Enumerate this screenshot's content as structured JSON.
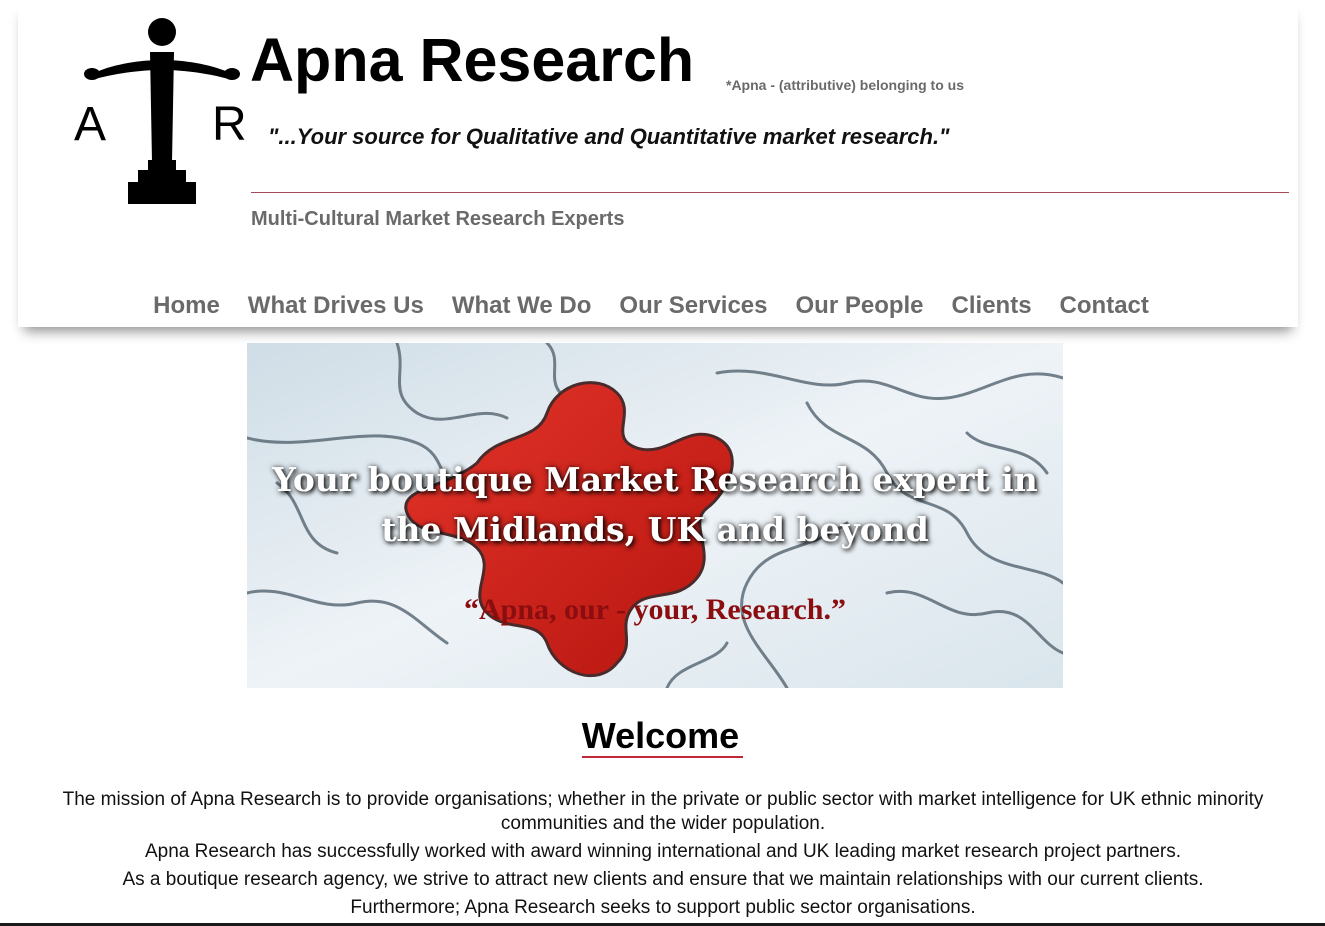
{
  "header": {
    "logo_letters": {
      "left": "A",
      "right": "R"
    },
    "title": "Apna Research",
    "title_note": "*Apna - (attributive) belonging to us",
    "tagline": "\"...Your source for Qualitative and Quantitative market research.\"",
    "subtitle": "Multi-Cultural Market Research Experts"
  },
  "nav": {
    "items": [
      {
        "label": "Home"
      },
      {
        "label": "What Drives Us"
      },
      {
        "label": "What We Do"
      },
      {
        "label": "Our Services"
      },
      {
        "label": "Our People"
      },
      {
        "label": "Clients"
      },
      {
        "label": "Contact"
      }
    ]
  },
  "hero": {
    "headline_line1": "Your boutique Market Research expert in",
    "headline_line2": "the Midlands, UK and beyond",
    "motto": "“Apna, our - your, Research.”"
  },
  "welcome": {
    "heading": "Welcome",
    "paragraphs": [
      "The mission of Apna Research is to provide organisations; whether in the private or public sector with market intelligence for UK ethnic minority communities and the wider population.",
      "Apna Research has successfully worked with award winning international and UK leading market research project partners.",
      "As a boutique research agency, we strive to attract new clients and ensure that we maintain relationships with our current clients.",
      "Furthermore; Apna Research seeks to support public sector organisations."
    ]
  },
  "colors": {
    "nav_text": "#6a6a6a",
    "divider": "#a24a55",
    "puzzle_red": "#d8231c",
    "motto_red": "#8a0d10",
    "welcome_underline": "#c0283a"
  }
}
